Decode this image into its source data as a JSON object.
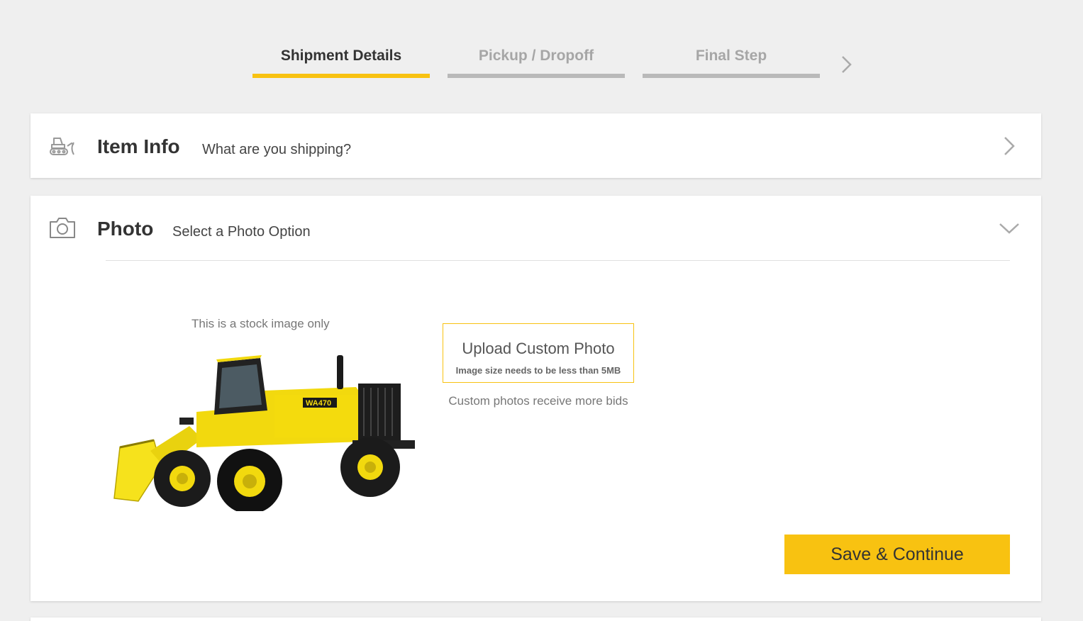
{
  "stepper": {
    "steps": [
      {
        "label": "Shipment Details",
        "state": "active"
      },
      {
        "label": "Pickup / Dropoff",
        "state": "inactive"
      },
      {
        "label": "Final Step",
        "state": "inactive"
      }
    ]
  },
  "item_info": {
    "title": "Item Info",
    "subtitle": "What are you shipping?",
    "icon": "bulldozer-icon"
  },
  "photo": {
    "title": "Photo",
    "subtitle": "Select a Photo Option",
    "icon": "camera-icon",
    "stock_caption": "This is a stock image only",
    "upload_title": "Upload Custom Photo",
    "upload_note": "Image size needs to be less than 5MB",
    "upload_hint": "Custom photos receive more bids",
    "save_label": "Save & Continue"
  },
  "colors": {
    "accent": "#f8c211",
    "background": "#efefef",
    "inactive_step": "#b9b9b9"
  }
}
